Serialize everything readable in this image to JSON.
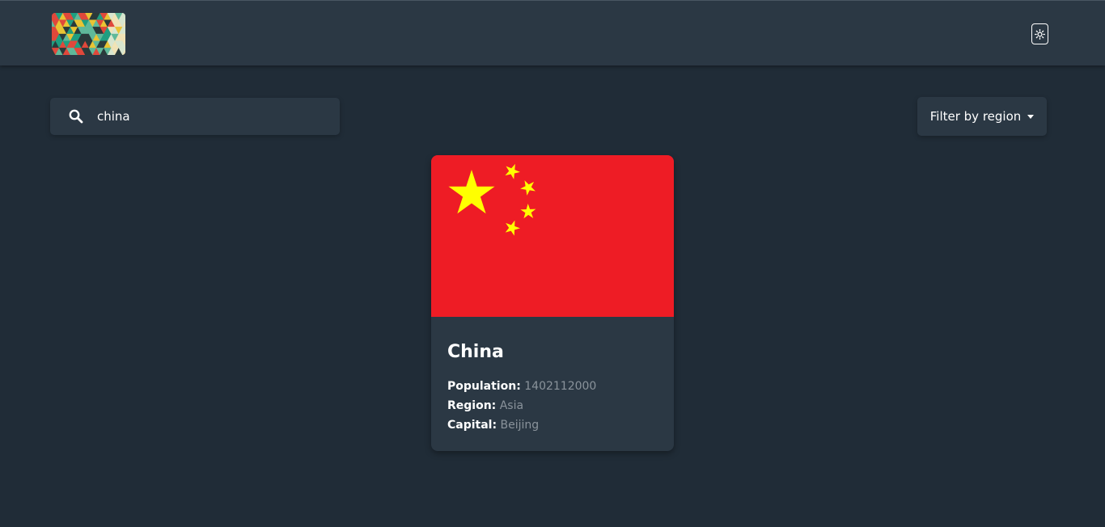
{
  "header": {
    "logo_icon": "colorful-triangle-mosaic-logo",
    "theme_toggle_icon": "sun-icon"
  },
  "search": {
    "icon": "search-icon",
    "value": "china",
    "placeholder": ""
  },
  "filter": {
    "label": "Filter by region",
    "icon": "caret-down-icon"
  },
  "results": [
    {
      "name": "China",
      "flag": "china-flag",
      "population_label": "Population:",
      "population": "1402112000",
      "region_label": "Region:",
      "region": "Asia",
      "capital_label": "Capital:",
      "capital": "Beijing"
    }
  ],
  "colors": {
    "background": "#202c37",
    "element": "#2b3844",
    "text": "#ffffff",
    "muted_text": "#8a939b",
    "flag_red": "#ee1c25",
    "flag_yellow": "#ffff00"
  }
}
